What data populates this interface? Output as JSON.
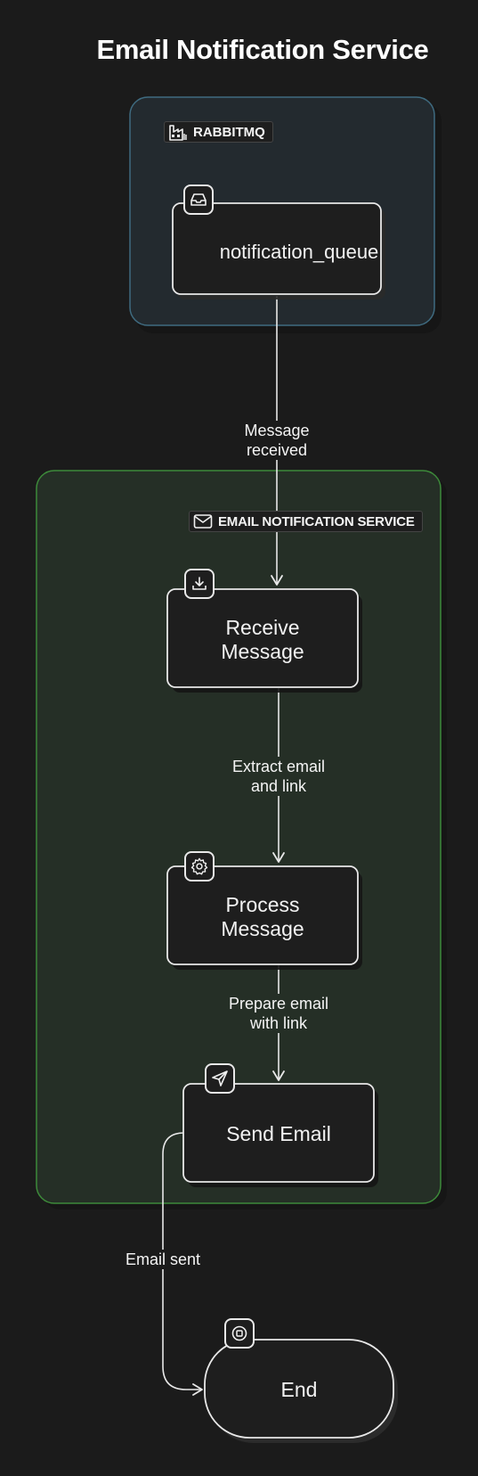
{
  "title": "Email Notification Service",
  "groups": {
    "rabbitmq": {
      "label": "RABBITMQ",
      "icon": "factory-icon"
    },
    "email_service": {
      "label": "EMAIL NOTIFICATION SERVICE",
      "icon": "envelope-icon"
    }
  },
  "nodes": {
    "queue": {
      "label": "notification_queue",
      "icon": "inbox-icon"
    },
    "receive": {
      "label": "Receive Message",
      "icon": "download-icon"
    },
    "process": {
      "label": "Process Message",
      "icon": "gear-icon"
    },
    "send": {
      "label": "Send Email",
      "icon": "send-icon"
    },
    "end": {
      "label": "End",
      "icon": "stop-icon"
    }
  },
  "edges": {
    "queue_to_receive": "Message\nreceived",
    "receive_to_process": "Extract email\nand link",
    "process_to_send": "Prepare email\nwith link",
    "send_to_end": "Email sent"
  },
  "colors": {
    "background": "#1b1b1b",
    "rabbitmq_group_fill": "#232a2f",
    "rabbitmq_group_stroke": "#3f6b80",
    "email_group_fill": "#252f26",
    "email_group_stroke": "#3d8a3a",
    "node_fill": "#1e1e1e",
    "stroke": "#e8e8e8"
  }
}
